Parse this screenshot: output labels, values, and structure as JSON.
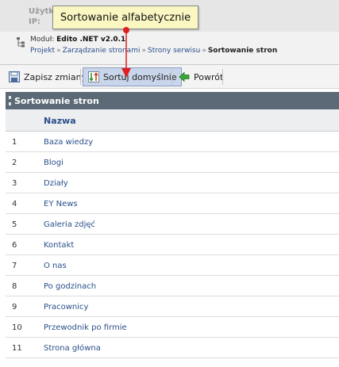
{
  "user_info": {
    "user_label": "Użytk",
    "ip_label": "IP:"
  },
  "module": {
    "label": "Moduł:",
    "name": "Edito .NET v2.0.1"
  },
  "breadcrumb": {
    "items": [
      "Projekt",
      "Zarządzanie stronami",
      "Strony serwisu"
    ],
    "separator": "»",
    "current": "Sortowanie stron"
  },
  "toolbar": {
    "save_label": "Zapisz zmiany",
    "sort_default_label": "Sortuj domyślnie",
    "back_label": "Powrót"
  },
  "tooltip": {
    "text": "Sortowanie alfabetycznie"
  },
  "panel": {
    "title": "Sortowanie stron",
    "column_name": "Nazwa"
  },
  "rows": [
    {
      "num": "1",
      "name": "Baza wiedzy"
    },
    {
      "num": "2",
      "name": "Blogi"
    },
    {
      "num": "3",
      "name": "Działy"
    },
    {
      "num": "4",
      "name": "EY News"
    },
    {
      "num": "5",
      "name": "Galeria zdjęć"
    },
    {
      "num": "6",
      "name": "Kontakt"
    },
    {
      "num": "7",
      "name": "O nas"
    },
    {
      "num": "8",
      "name": "Po godzinach"
    },
    {
      "num": "9",
      "name": "Pracownicy"
    },
    {
      "num": "10",
      "name": "Przewodnik po firmie"
    },
    {
      "num": "11",
      "name": "Strona główna"
    }
  ],
  "colors": {
    "panel_header": "#5b6a76",
    "link": "#2a4f8a",
    "tooltip_bg": "#fbf7c2",
    "pointer": "#e02020",
    "active_button": "#c9d5ea"
  },
  "icons": {
    "module": "module-tree-icon",
    "save": "save-disk-icon",
    "sort": "sort-arrows-icon",
    "back": "back-arrow-icon"
  }
}
